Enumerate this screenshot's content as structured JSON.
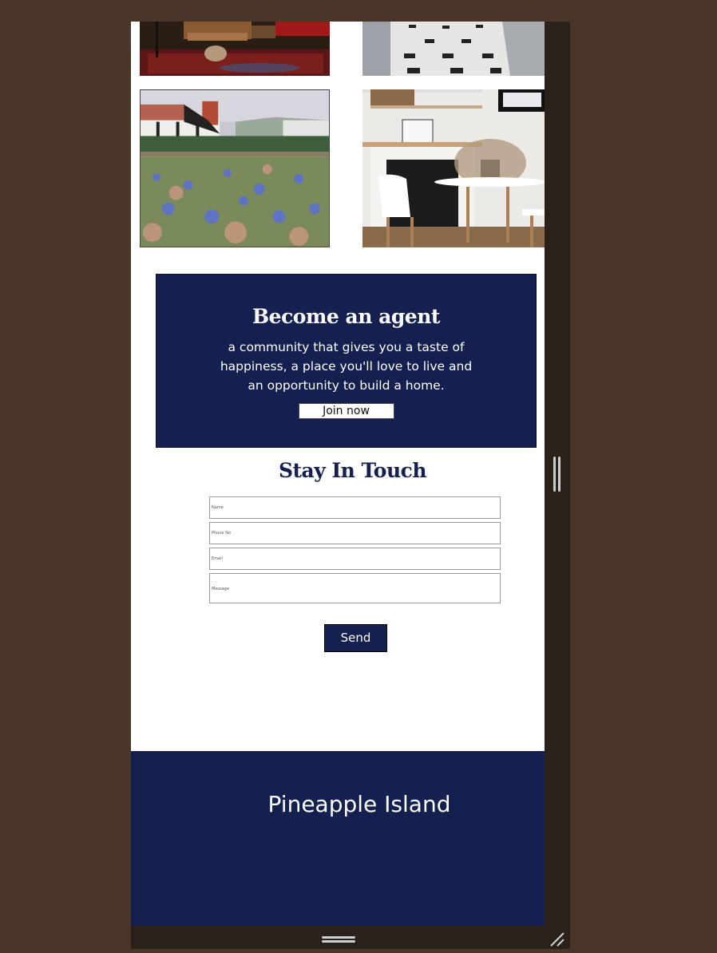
{
  "agent": {
    "title": "Become an agent",
    "description": "a community that gives you a taste of happiness, a place you'll love to live and an opportunity to build a home.",
    "button_label": "Join now"
  },
  "contact": {
    "title": "Stay In Touch",
    "fields": {
      "name": "Name",
      "phone": "Phone No",
      "email": "Email",
      "message": "Message"
    },
    "send_label": "Send"
  },
  "footer": {
    "brand": "Pineapple Island"
  },
  "colors": {
    "navy": "#14204f",
    "frame": "#2b211b",
    "background": "#4a3628"
  },
  "icons": {
    "vertical_handle": "drag-handle-vertical-icon",
    "horizontal_handle": "drag-handle-horizontal-icon",
    "resize": "resize-grip-icon"
  }
}
